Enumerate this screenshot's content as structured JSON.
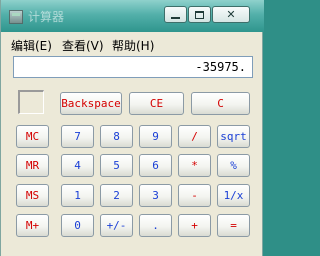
{
  "window": {
    "title": "计算器"
  },
  "menu": {
    "edit": "编辑(E)",
    "view": "查看(V)",
    "help": "帮助(H)"
  },
  "display": {
    "value": "-35975."
  },
  "buttons": {
    "backspace": "Backspace",
    "ce": "CE",
    "c": "C",
    "mc": "MC",
    "mr": "MR",
    "ms": "MS",
    "mplus": "M+",
    "d7": "7",
    "d8": "8",
    "d9": "9",
    "divide": "/",
    "sqrt": "sqrt",
    "d4": "4",
    "d5": "5",
    "d6": "6",
    "multiply": "*",
    "percent": "%",
    "d1": "1",
    "d2": "2",
    "d3": "3",
    "minus": "-",
    "reciprocal": "1/x",
    "d0": "0",
    "plusminus": "+/-",
    "decimal": ".",
    "plus": "+",
    "equals": "="
  },
  "colors": {
    "red_label": "#d40000",
    "blue_label": "#1a3fd6",
    "titlebar": "#53b0aa",
    "window_bg": "#ece9d8"
  },
  "icons": {
    "app": "calculator-icon",
    "minimize": "minimize-icon",
    "maximize": "maximize-icon",
    "close": "close-icon"
  }
}
